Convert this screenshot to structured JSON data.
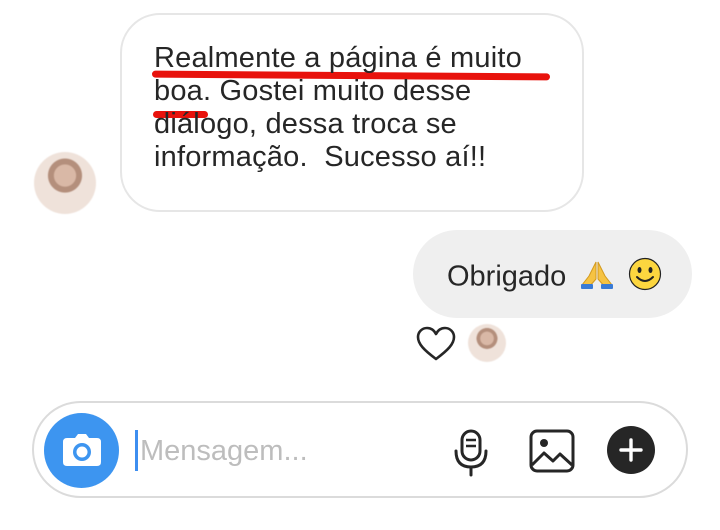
{
  "conversation": {
    "incoming_message": "Realmente a página é muito\nboa. Gostei muito desse\ndiálogo, dessa troca se\ninformação.  Sucesso aí!!",
    "outgoing_message": "Obrigado",
    "outgoing_emojis": [
      "folded-hands-emoji",
      "slightly-smiling-face-emoji"
    ],
    "reaction": "heart-icon"
  },
  "composer": {
    "placeholder": "Mensagem...",
    "icons": {
      "camera": "camera-icon",
      "mic": "microphone-icon",
      "gallery": "gallery-icon",
      "plus": "plus-icon"
    }
  },
  "colors": {
    "annotation_red": "#e8120c",
    "camera_blue": "#3d95f0",
    "caret_blue": "#3d8ef0",
    "outgoing_bubble": "#efefef",
    "border_gray": "#e6e6e6",
    "placeholder_gray": "#bdbdbd",
    "dark": "#262626"
  }
}
